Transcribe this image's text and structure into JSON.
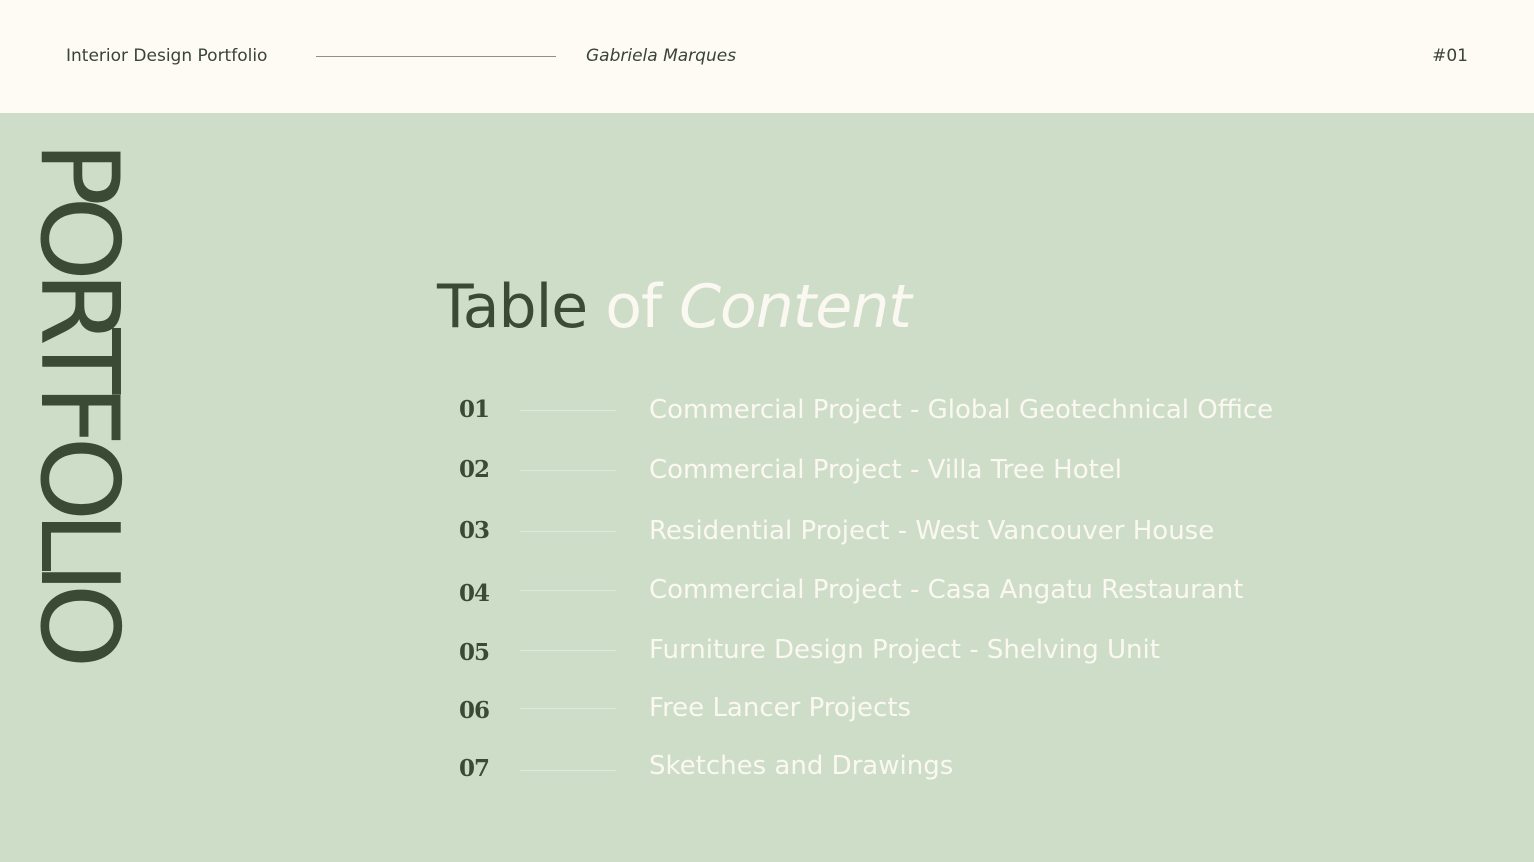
{
  "header": {
    "portfolio_label": "Interior Design Portfolio",
    "author": "Gabriela Marques",
    "page_number": "#01"
  },
  "side_word": "PORTFOLIO",
  "title": {
    "part1": "Table",
    "part2": "of",
    "part3": "Content"
  },
  "toc": {
    "items": [
      {
        "number": "01",
        "label": "Commercial Project - Global Geotechnical Office"
      },
      {
        "number": "02",
        "label": "Commercial Project - Villa Tree Hotel"
      },
      {
        "number": "03",
        "label": "Residential Project - West Vancouver House"
      },
      {
        "number": "04",
        "label": "Commercial Project - Casa Angatu Restaurant"
      },
      {
        "number": "05",
        "label": "Furniture Design Project - Shelving Unit"
      },
      {
        "number": "06",
        "label": "Free Lancer Projects"
      },
      {
        "number": "07",
        "label": "Sketches and Drawings"
      }
    ]
  },
  "colors": {
    "header_bg": "#fefaf4",
    "main_bg": "#ceddc8",
    "dark_green": "#3b4a35",
    "light_text": "#fbf8f2"
  }
}
